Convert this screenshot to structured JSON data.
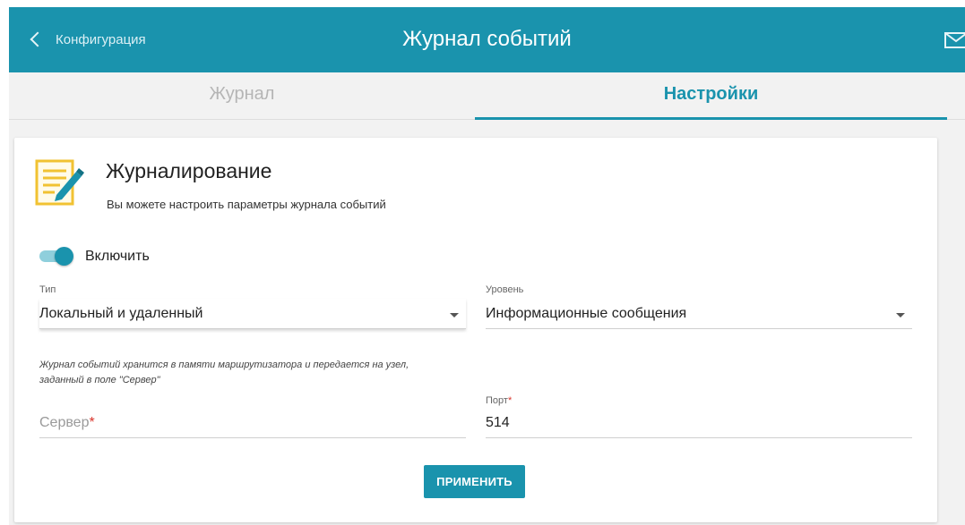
{
  "header": {
    "back_label": "Конфигурация",
    "title": "Журнал событий",
    "mail_icon": "envelope-icon"
  },
  "tabs": [
    {
      "label": "Журнал",
      "active": false
    },
    {
      "label": "Настройки",
      "active": true
    }
  ],
  "section": {
    "icon": "log-edit-icon",
    "title": "Журналирование",
    "subtitle": "Вы можете настроить параметры журнала событий"
  },
  "enable": {
    "label": "Включить",
    "checked": true
  },
  "type_field": {
    "label": "Тип",
    "value": "Локальный и удаленный"
  },
  "level_field": {
    "label": "Уровень",
    "value": "Информационные сообщения"
  },
  "hint": {
    "line1": "Журнал событий хранится в памяти маршрутизатора и передается на узел,",
    "line2": "заданный в поле \"Сервер\""
  },
  "server_field": {
    "placeholder": "Сервер",
    "required_mark": "*",
    "value": ""
  },
  "port_field": {
    "label": "Порт",
    "required_mark": "*",
    "value": "514"
  },
  "apply_button": {
    "label": "ПРИМЕНИТЬ"
  },
  "colors": {
    "accent": "#1a93ad",
    "toggle_track": "#8fcfdc",
    "required": "#d9342b",
    "icon_yellow": "#f1c232"
  }
}
